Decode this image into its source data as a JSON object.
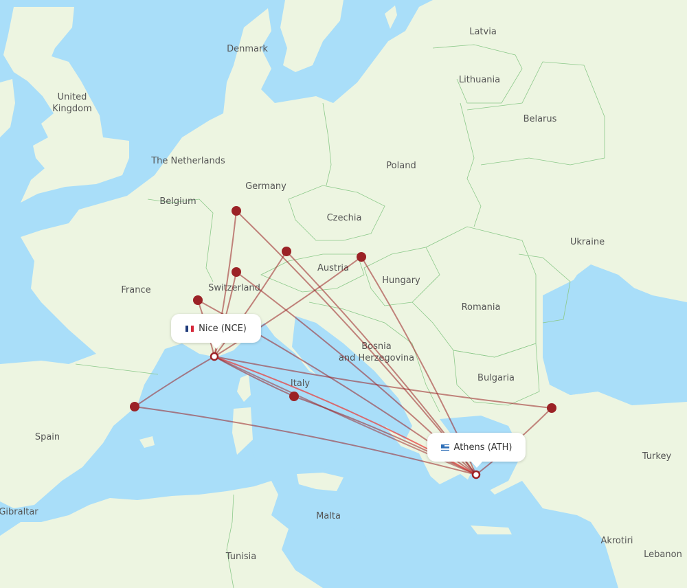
{
  "map": {
    "colors": {
      "water": "#a9def9",
      "land": "#edf5e1",
      "border": "#8cc98a",
      "route": "#9b2226",
      "route_highlight": "#e8423f",
      "label": "#555555"
    },
    "country_labels": [
      {
        "id": "latvia",
        "text": "Latvia"
      },
      {
        "id": "denmark",
        "text": "Denmark"
      },
      {
        "id": "lithuania",
        "text": "Lithuania"
      },
      {
        "id": "united-kingdom-1",
        "text": "United"
      },
      {
        "id": "united-kingdom-2",
        "text": "Kingdom"
      },
      {
        "id": "belarus",
        "text": "Belarus"
      },
      {
        "id": "the-netherlands",
        "text": "The Netherlands"
      },
      {
        "id": "poland",
        "text": "Poland"
      },
      {
        "id": "germany",
        "text": "Germany"
      },
      {
        "id": "belgium",
        "text": "Belgium"
      },
      {
        "id": "czechia",
        "text": "Czechia"
      },
      {
        "id": "ukraine",
        "text": "Ukraine"
      },
      {
        "id": "austria",
        "text": "Austria"
      },
      {
        "id": "hungary",
        "text": "Hungary"
      },
      {
        "id": "switzerland",
        "text": "Switzerland"
      },
      {
        "id": "france",
        "text": "France"
      },
      {
        "id": "romania",
        "text": "Romania"
      },
      {
        "id": "bosnia-1",
        "text": "Bosnia"
      },
      {
        "id": "bosnia-2",
        "text": "and Herzegovina"
      },
      {
        "id": "bulgaria",
        "text": "Bulgaria"
      },
      {
        "id": "italy",
        "text": "Italy"
      },
      {
        "id": "spain",
        "text": "Spain"
      },
      {
        "id": "turkey",
        "text": "Turkey"
      },
      {
        "id": "gibraltar",
        "text": "Gibraltar"
      },
      {
        "id": "malta",
        "text": "Malta"
      },
      {
        "id": "tunisia",
        "text": "Tunisia"
      },
      {
        "id": "akrotiri",
        "text": "Akrotiri"
      },
      {
        "id": "lebanon",
        "text": "Lebanon"
      }
    ],
    "origin": {
      "name": "Nice (NCE)",
      "flag": "france-flag"
    },
    "destination": {
      "name": "Athens (ATH)",
      "flag": "greece-flag"
    },
    "stopovers": [
      {
        "id": "frankfurt"
      },
      {
        "id": "munich"
      },
      {
        "id": "zurich"
      },
      {
        "id": "geneva"
      },
      {
        "id": "vienna"
      },
      {
        "id": "rome"
      },
      {
        "id": "barcelona"
      },
      {
        "id": "istanbul"
      }
    ]
  }
}
